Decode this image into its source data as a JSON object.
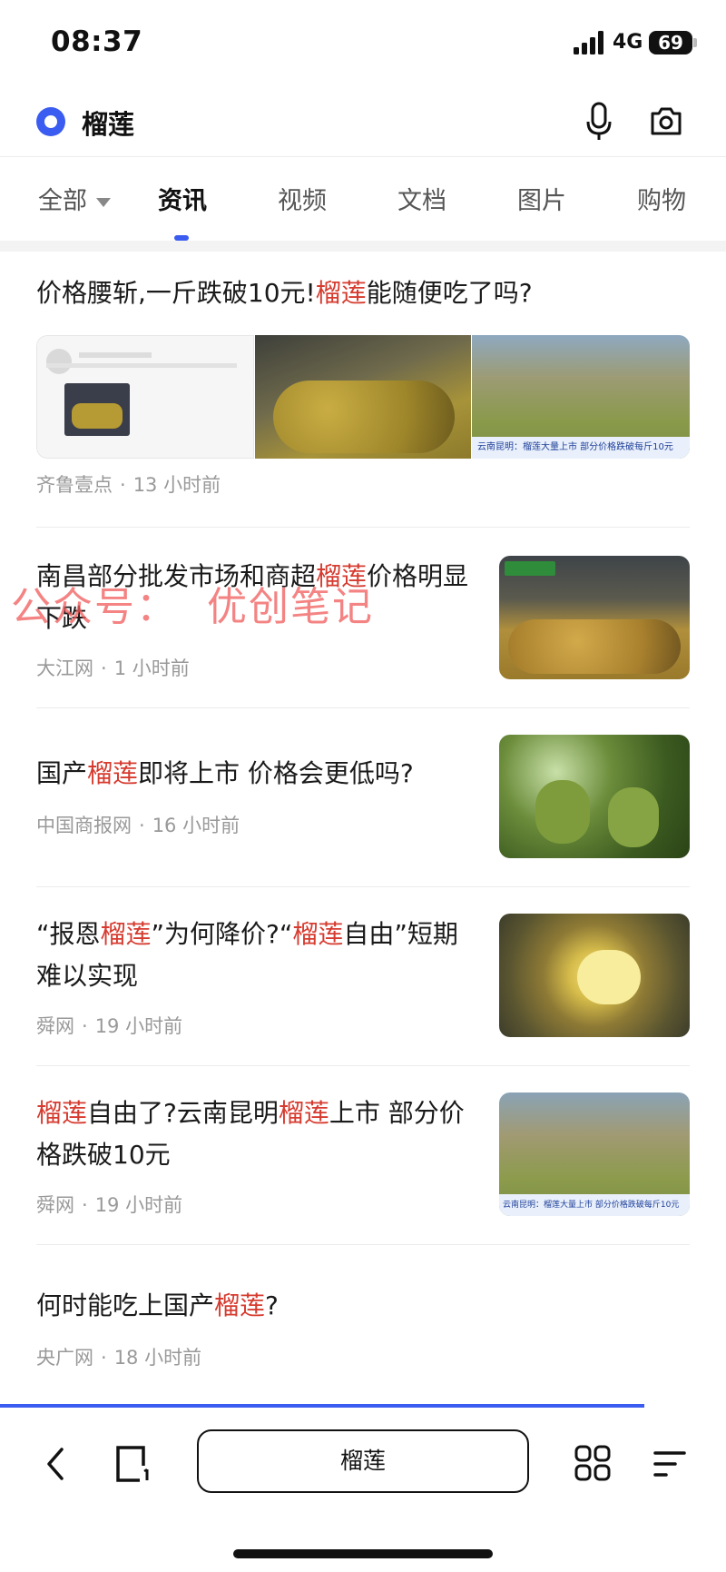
{
  "status_bar": {
    "time": "08:37",
    "network": "4G",
    "battery": "69"
  },
  "search": {
    "query": "榴莲"
  },
  "tabs": [
    {
      "label": "全部",
      "active": false,
      "has_dropdown": true
    },
    {
      "label": "资讯",
      "active": true
    },
    {
      "label": "视频",
      "active": false
    },
    {
      "label": "文档",
      "active": false
    },
    {
      "label": "图片",
      "active": false
    },
    {
      "label": "购物",
      "active": false
    }
  ],
  "news": [
    {
      "title_parts": [
        "价格腰斩,一斤跌破10元!",
        "榴莲",
        "能随便吃了吗?"
      ],
      "source": "齐鲁壹点",
      "time": "13 小时前",
      "image_caption": "云南昆明：榴莲大量上市 部分价格跌破每斤10元"
    },
    {
      "title_parts": [
        "南昌部分批发市场和商超",
        "榴莲",
        "价格明显下跌"
      ],
      "source": "大江网",
      "time": "1 小时前"
    },
    {
      "title_parts": [
        "国产",
        "榴莲",
        "即将上市 价格会更低吗?"
      ],
      "source": "中国商报网",
      "time": "16 小时前"
    },
    {
      "title_parts": [
        "“报恩",
        "榴莲",
        "”为何降价?“",
        "榴莲",
        "自由”短期难以实现"
      ],
      "source": "舜网",
      "time": "19 小时前"
    },
    {
      "title_parts": [
        "榴莲",
        "自由了?云南昆明",
        "榴莲",
        "上市 部分价格跌破10元"
      ],
      "source": "舜网",
      "time": "19 小时前",
      "image_caption": "云南昆明：榴莲大量上市 部分价格跌破每斤10元"
    },
    {
      "title_parts": [
        "何时能吃上国产",
        "榴莲",
        "?"
      ],
      "source": "央广网",
      "time": "18 小时前"
    }
  ],
  "watermark": "公众号：  优创笔记",
  "bottom_bar": {
    "search_label": "榴莲"
  },
  "colors": {
    "accent": "#3b5cf0",
    "highlight": "#d63b2f",
    "meta": "#999999"
  }
}
